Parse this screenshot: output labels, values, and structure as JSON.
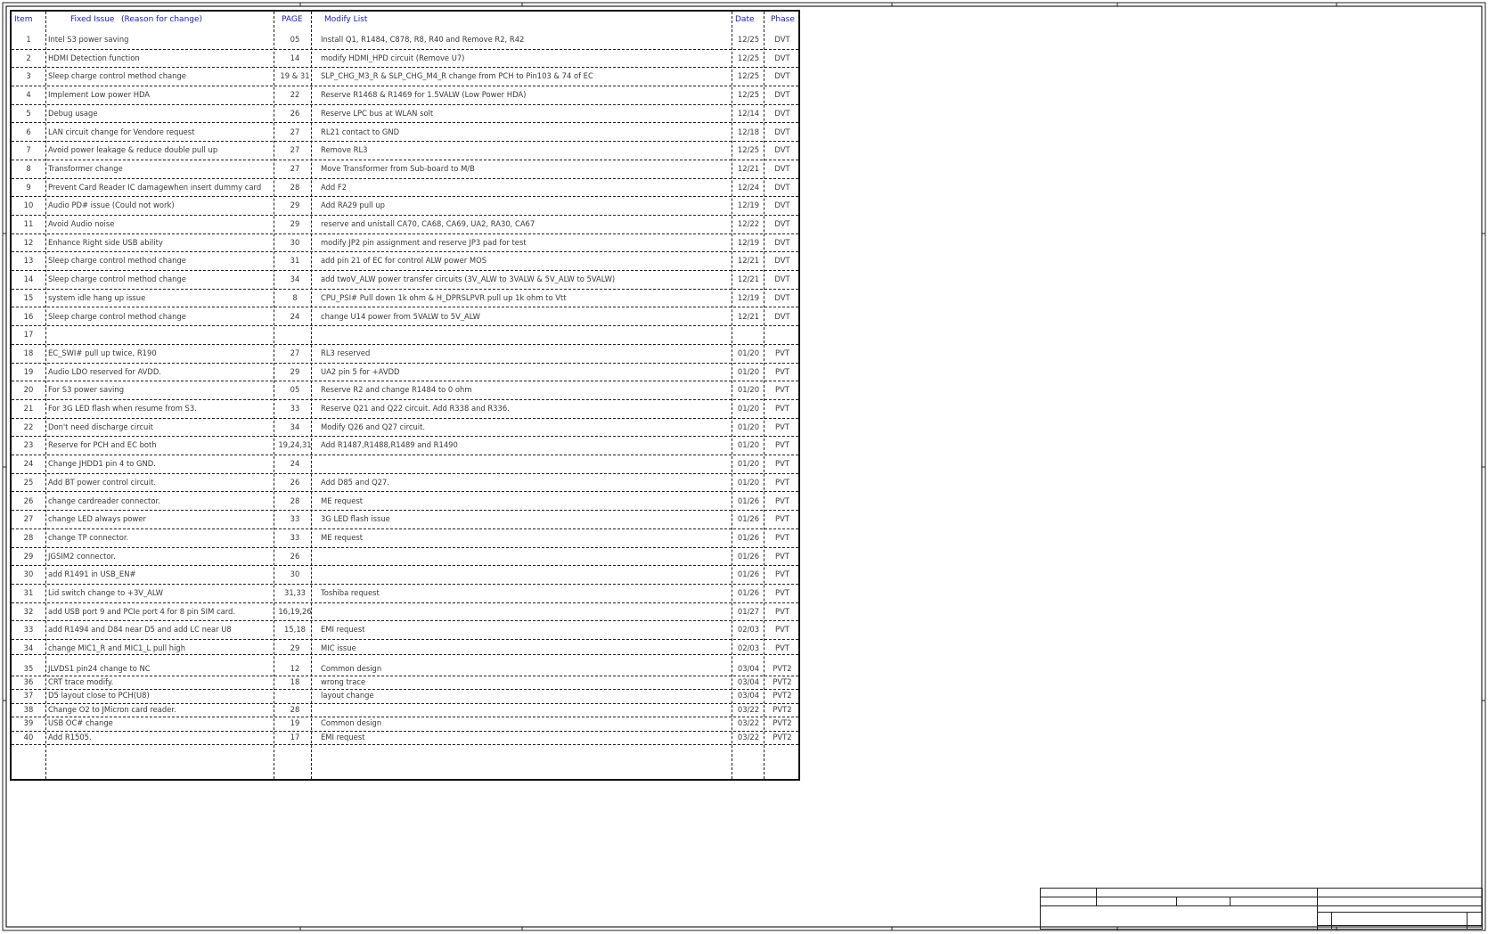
{
  "header": {
    "item": "Item",
    "fixed_issue": "Fixed Issue",
    "reason": "(Reason for change)",
    "page": "PAGE",
    "modify_list": "Modify List",
    "date": "Date",
    "phase": "Phase"
  },
  "rows": [
    {
      "item": "1",
      "issue": "Intel S3 power saving",
      "page": "05",
      "modify": "Install Q1, R1484, C878, R8, R40 and Remove R2, R42",
      "date": "12/25",
      "phase": "DVT"
    },
    {
      "item": "2",
      "issue": "HDMI Detection function",
      "page": "14",
      "modify": "modify HDMI_HPD circuit (Remove U7)",
      "date": "12/25",
      "phase": "DVT"
    },
    {
      "item": "3",
      "issue": "Sleep charge control method change",
      "page": "19 & 31",
      "modify": "SLP_CHG_M3_R & SLP_CHG_M4_R change from PCH to Pin103 & 74 of EC",
      "date": "12/25",
      "phase": "DVT"
    },
    {
      "item": "4",
      "issue": "Implement Low power HDA",
      "page": "22",
      "modify": "Reserve R1468 & R1469 for 1.5VALW (Low Power HDA)",
      "date": "12/25",
      "phase": "DVT"
    },
    {
      "item": "5",
      "issue": "Debug usage",
      "page": "26",
      "modify": "Reserve LPC bus at WLAN solt",
      "date": "12/14",
      "phase": "DVT"
    },
    {
      "item": "6",
      "issue": "LAN circuit change for Vendore request",
      "page": "27",
      "modify": "RL21 contact to GND",
      "date": "12/18",
      "phase": "DVT"
    },
    {
      "item": "7",
      "issue": "Avoid power leakage & reduce double pull up",
      "page": "27",
      "modify": "Remove RL3",
      "date": "12/25",
      "phase": "DVT"
    },
    {
      "item": "8",
      "issue": "Transformer change",
      "page": "27",
      "modify": "Move Transformer from Sub-board to M/B",
      "date": "12/21",
      "phase": "DVT"
    },
    {
      "item": "9",
      "issue": "Prevent Card Reader IC damagewhen insert dummy card",
      "page": "28",
      "modify": "Add F2",
      "date": "12/24",
      "phase": "DVT"
    },
    {
      "item": "10",
      "issue": "Audio PD# issue (Could not work)",
      "page": "29",
      "modify": "Add RA29 pull up",
      "date": "12/19",
      "phase": "DVT"
    },
    {
      "item": "11",
      "issue": "Avoid Audio noise",
      "page": "29",
      "modify": "reserve and unistall CA70, CA68, CA69, UA2, RA30, CA67",
      "date": "12/22",
      "phase": "DVT"
    },
    {
      "item": "12",
      "issue": "Enhance Right side USB ability",
      "page": "30",
      "modify": "modify JP2 pin assignment and reserve JP3 pad for test",
      "date": "12/19",
      "phase": "DVT"
    },
    {
      "item": "13",
      "issue": "Sleep charge control method change",
      "page": "31",
      "modify": "add pin 21 of EC for control ALW power MOS",
      "date": "12/21",
      "phase": "DVT"
    },
    {
      "item": "14",
      "issue": "Sleep charge control method change",
      "page": "34",
      "modify": "add twoV_ALW power transfer circuits (3V_ALW to 3VALW & 5V_ALW to 5VALW)",
      "date": "12/21",
      "phase": "DVT"
    },
    {
      "item": "15",
      "issue": "system idle hang up issue",
      "page": "8",
      "modify": "CPU_PSI# Pull down 1k ohm & H_DPRSLPVR pull up 1k ohm to Vtt",
      "date": "12/19",
      "phase": "DVT"
    },
    {
      "item": "16",
      "issue": "Sleep charge control method change",
      "page": "24",
      "modify": "change U14 power from 5VALW to 5V_ALW",
      "date": "12/21",
      "phase": "DVT"
    },
    {
      "item": "17",
      "issue": "",
      "page": "",
      "modify": "",
      "date": "",
      "phase": ""
    },
    {
      "item": "18",
      "issue": "EC_SWI# pull up twice, R190",
      "page": "27",
      "modify": "RL3 reserved",
      "date": "01/20",
      "phase": "PVT"
    },
    {
      "item": "19",
      "issue": "Audio LDO reserved for AVDD.",
      "page": "29",
      "modify": "UA2 pin 5 for +AVDD",
      "date": "01/20",
      "phase": "PVT"
    },
    {
      "item": "20",
      "issue": "For S3 power saving",
      "page": "05",
      "modify": "Reserve R2 and change R1484 to 0 ohm",
      "date": "01/20",
      "phase": "PVT"
    },
    {
      "item": "21",
      "issue": "For 3G LED flash when resume from S3.",
      "page": "33",
      "modify": "Reserve Q21 and Q22 circuit. Add R338 and R336.",
      "date": "01/20",
      "phase": "PVT"
    },
    {
      "item": "22",
      "issue": "Don't need discharge circuit",
      "page": "34",
      "modify": "Modify Q26 and Q27 circuit.",
      "date": "01/20",
      "phase": "PVT"
    },
    {
      "item": "23",
      "issue": "Reserve for PCH and EC both",
      "page": "19,24,31",
      "modify": "Add R1487,R1488,R1489 and R1490",
      "date": "01/20",
      "phase": "PVT"
    },
    {
      "item": "24",
      "issue": "Change JHDD1 pin 4 to GND.",
      "page": "24",
      "modify": "",
      "date": "01/20",
      "phase": "PVT"
    },
    {
      "item": "25",
      "issue": "Add BT power control circuit.",
      "page": "26",
      "modify": "Add D85 and Q27.",
      "date": "01/20",
      "phase": "PVT"
    },
    {
      "item": "26",
      "issue": "change cardreader connector.",
      "page": "28",
      "modify": "ME request",
      "date": "01/26",
      "phase": "PVT"
    },
    {
      "item": "27",
      "issue": "change LED always power",
      "page": "33",
      "modify": "3G LED flash issue",
      "date": "01/26",
      "phase": "PVT"
    },
    {
      "item": "28",
      "issue": "change TP connector.",
      "page": "33",
      "modify": "ME request",
      "date": "01/26",
      "phase": "PVT"
    },
    {
      "item": "29",
      "issue": "JGSIM2 connector.",
      "page": "26",
      "modify": "",
      "date": "01/26",
      "phase": "PVT"
    },
    {
      "item": "30",
      "issue": "add R1491 in USB_EN#",
      "page": "30",
      "modify": "",
      "date": "01/26",
      "phase": "PVT"
    },
    {
      "item": "31",
      "issue": "Lid switch change to +3V_ALW",
      "page": "31,33",
      "modify": "Toshiba request",
      "date": "01/26",
      "phase": "PVT"
    },
    {
      "item": "32",
      "issue": "add USB port 9 and PCIe port 4 for 8 pin SIM card.",
      "page": "16,19,26",
      "modify": "",
      "date": "01/27",
      "phase": "PVT"
    },
    {
      "item": "33",
      "issue": "add R1494 and D84 near D5 and add LC near U8",
      "page": "15,18",
      "modify": "EMI request",
      "date": "02/03",
      "phase": "PVT"
    },
    {
      "item": "34",
      "issue": "change MIC1_R and MIC1_L pull high",
      "page": "29",
      "modify": "MIC issue",
      "date": "02/03",
      "phase": "PVT"
    },
    {
      "item": "35",
      "issue": "JLVDS1 pin24 change to NC",
      "page": "12",
      "modify": "Common design",
      "date": "03/04",
      "phase": "PVT2"
    },
    {
      "item": "36",
      "issue": "CRT trace modify.",
      "page": "18",
      "modify": "wrong trace",
      "date": "03/04",
      "phase": "PVT2"
    },
    {
      "item": "37",
      "issue": "D5 layout close to PCH(U8)",
      "page": "",
      "modify": "layout change",
      "date": "03/04",
      "phase": "PVT2"
    },
    {
      "item": "38",
      "issue": "Change O2 to JMicron card reader.",
      "page": "28",
      "modify": "",
      "date": "03/22",
      "phase": "PVT2"
    },
    {
      "item": "39",
      "issue": "USB OC# change",
      "page": "19",
      "modify": "Common design",
      "date": "03/22",
      "phase": "PVT2"
    },
    {
      "item": "40",
      "issue": "Add R1505.",
      "page": "17",
      "modify": "EMI request",
      "date": "03/22",
      "phase": "PVT2"
    }
  ]
}
